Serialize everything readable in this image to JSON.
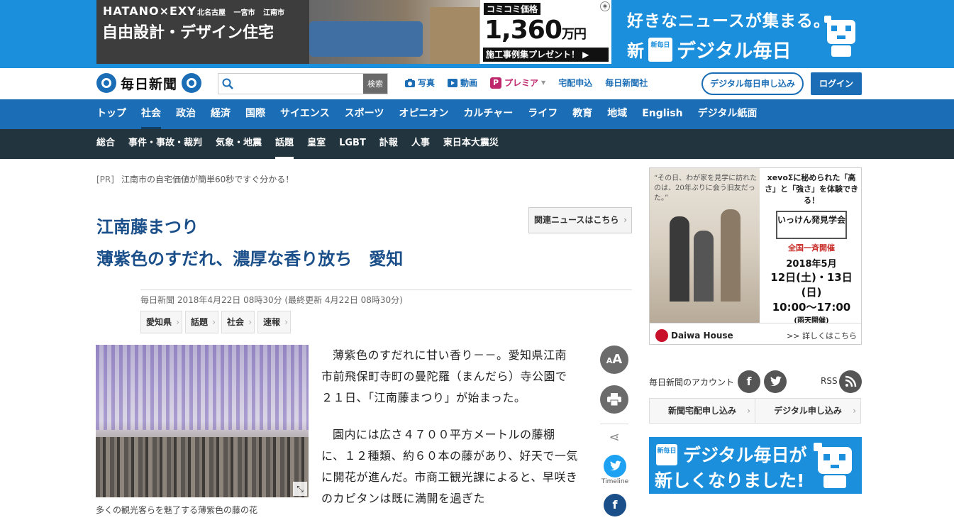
{
  "top_ad": {
    "brand": "HATANO×EXY",
    "areas": "北名古屋 一宮市 江南市",
    "headline": "自由設計・デザイン住宅",
    "price_label": "コミコミ価格",
    "price": "1,360",
    "price_unit": "万円",
    "cta": "施工事例集プレゼント！ ▶"
  },
  "promo": {
    "line1": "好きなニュースが集まる。",
    "new": "新",
    "badge": "新毎日",
    "title": "デジタル毎日"
  },
  "header": {
    "logo_text": "毎日新聞",
    "search_placeholder": "",
    "search_button": "検索",
    "nav": {
      "photo": "写真",
      "video": "動画",
      "premier": "プレミア",
      "delivery": "宅配申込",
      "company": "毎日新聞社"
    },
    "subscribe": "デジタル毎日申し込み",
    "login": "ログイン"
  },
  "category_nav": [
    "トップ",
    "社会",
    "政治",
    "経済",
    "国際",
    "サイエンス",
    "スポーツ",
    "オピニオン",
    "カルチャー",
    "ライフ",
    "教育",
    "地域",
    "English",
    "デジタル紙面"
  ],
  "sub_nav": [
    "総合",
    "事件・事故・裁判",
    "気象・地震",
    "話題",
    "皇室",
    "LGBT",
    "訃報",
    "人事",
    "東日本大震災"
  ],
  "article": {
    "pr_tag": "[PR]",
    "pr_text": "江南市の自宅価値が簡単60秒ですぐ分かる！",
    "related": "関連ニュースはこちら",
    "kicker": "江南藤まつり",
    "headline": "薄紫色のすだれ、濃厚な香り放ち　愛知",
    "meta": "毎日新聞 2018年4月22日 08時30分 (最終更新 4月22日 08時30分)",
    "tags": [
      "愛知県",
      "話題",
      "社会",
      "速報"
    ],
    "caption": "多くの観光客らを魅了する薄紫色の藤の花",
    "paragraphs": [
      "薄紫色のすだれに甘い香り－－。愛知県江南市前飛保町寺町の曼陀羅（まんだら）寺公園で２１日、「江南藤まつり」が始まった。",
      "園内には広さ４７００平方メートルの藤棚に、１２種類、約６０本の藤があり、好天で一気に開花が進んだ。市商工観光課によると、早咲きのカピタンは既に満開を過ぎた"
    ],
    "tools": {
      "font_size": "A",
      "font_size_small": "A",
      "timeline_label": "Timeline"
    }
  },
  "side_ad": {
    "quote": "“その日、わが家を見学に訪れたのは、20年ぶりに会う旧友だった。”",
    "head": "xevoΣに秘められた「高さ」と「強さ」を体験できる！",
    "event": "いっけん発見学会",
    "event_sub": "全国一斉開催",
    "date": "2018年5月",
    "days": "12日(土)・13日(日)",
    "time": "10:00～17:00",
    "note": "(雨天開催)",
    "brand": "Daiwa House",
    "more": ">> 詳しくはこちら"
  },
  "sidebar": {
    "account_label": "毎日新聞のアカウント",
    "rss": "RSS",
    "buttons": [
      "新聞宅配申し込み",
      "デジタル申し込み"
    ],
    "digital_badge": "新毎日",
    "digital_line1": "デジタル毎日が",
    "digital_line2": "新しくなりました!"
  },
  "colors": {
    "brand_blue": "#1b6db5",
    "promo_blue": "#1b8fdc",
    "subnav_dark": "#22353f",
    "headline_blue": "#1b4f8a"
  }
}
